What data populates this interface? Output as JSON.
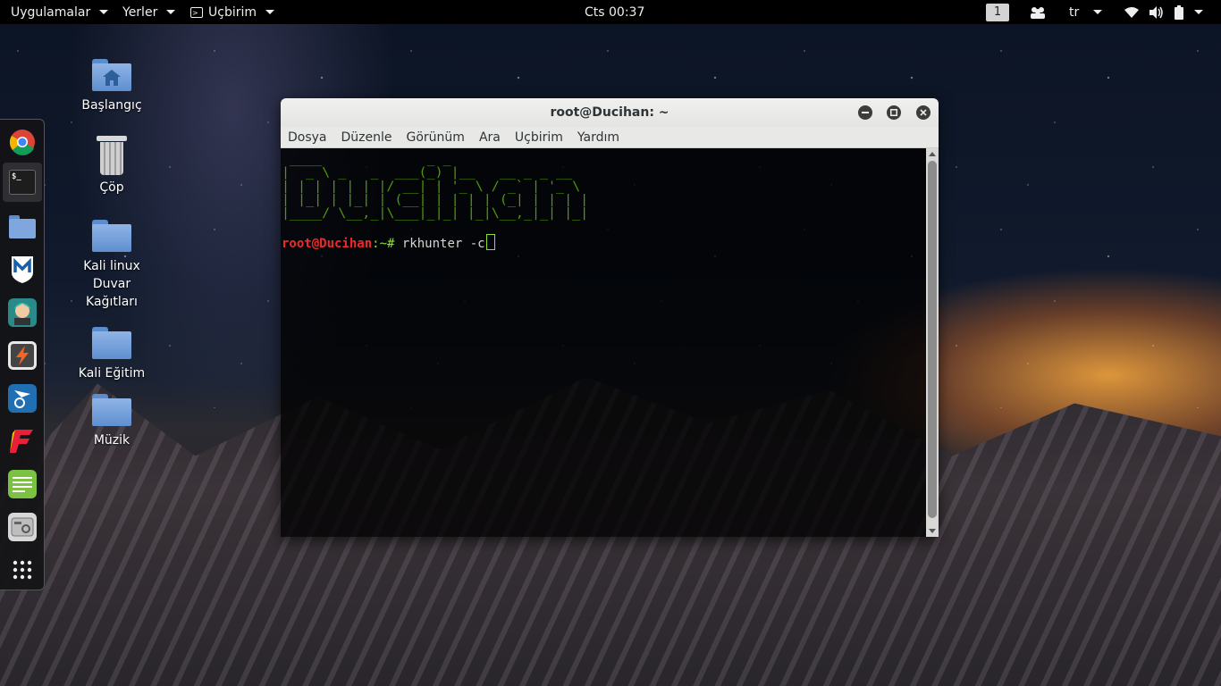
{
  "topbar": {
    "apps_label": "Uygulamalar",
    "places_label": "Yerler",
    "terminal_label": "Uçbirim",
    "clock": "Cts 00:37",
    "workspace": "1",
    "lang": "tr"
  },
  "desktop": {
    "icons": [
      {
        "label": "Başlangıç"
      },
      {
        "label": "Çöp"
      },
      {
        "label": "Kali linux Duvar Kağıtları"
      },
      {
        "label": "Kali Eğitim"
      },
      {
        "label": "Müzik"
      }
    ]
  },
  "terminal": {
    "title": "root@Ducihan: ~",
    "menu": [
      "Dosya",
      "Düzenle",
      "Görünüm",
      "Ara",
      "Uçbirim",
      "Yardım"
    ],
    "banner": " ____             _ _                 \n|  _ \\ _   _  ___(_) |__   __ _ _ __  \n| | | | | | |/ __| | '_ \\ / _` | '_ \\ \n| |_| | |_| | (__| | | | | (_| | | | |\n|____/ \\__,_|\\___|_|_| |_|\\__,_|_| |_|",
    "prompt_user": "root@Ducihan",
    "prompt_sep": ":~# ",
    "command": "rkhunter -c"
  },
  "colors": {
    "banner_green": "#4e9a06",
    "prompt_red": "#ef2929",
    "prompt_green": "#8ae234"
  },
  "dock": {
    "icons": [
      "chrome-icon",
      "terminal-icon",
      "files-icon",
      "metasploit-icon",
      "armitage-icon",
      "burpsuite-icon",
      "maltego-icon",
      "faraday-icon",
      "leafpad-icon",
      "cutycapt-icon",
      "show-apps-icon"
    ]
  }
}
